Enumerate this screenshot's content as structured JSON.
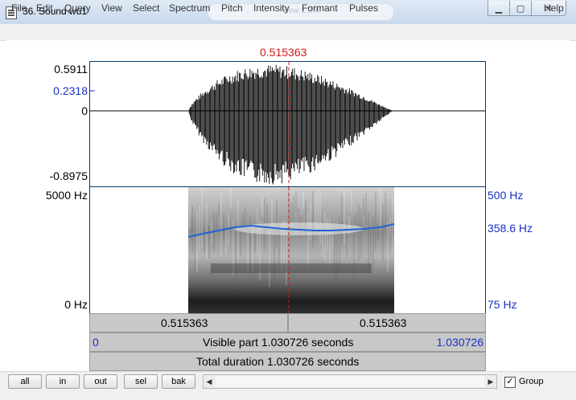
{
  "window": {
    "title": "36. Sound wu1",
    "ghost_text": "View 1.2.8"
  },
  "menu": {
    "items": [
      "File",
      "Edit",
      "Query",
      "View",
      "Select",
      "Spectrum",
      "Pitch",
      "Intensity",
      "Formant",
      "Pulses"
    ],
    "help": "Help"
  },
  "cursor": {
    "time_label": "0.515363"
  },
  "waveform": {
    "y_max": "0.5911",
    "y_cursor": "0.2318",
    "y_zero": "0",
    "y_min": "-0.8975"
  },
  "spectrogram": {
    "freq_top": "5000 Hz",
    "freq_bottom": "0 Hz",
    "pitch_top": "500 Hz",
    "pitch_current": "358.6 Hz",
    "pitch_bottom": "75 Hz"
  },
  "bars": {
    "left_half": "0.515363",
    "right_half": "0.515363",
    "visible_start": "0",
    "visible_label": "Visible part 1.030726 seconds",
    "visible_end": "1.030726",
    "total_label": "Total duration 1.030726 seconds"
  },
  "toolbar": {
    "buttons": [
      "all",
      "in",
      "out",
      "sel",
      "bak"
    ],
    "group_label": "Group",
    "group_checked": true
  },
  "colors": {
    "cursor": "#d01818",
    "pitch_line": "#1f62d8",
    "axis_blue": "#1a2fc4"
  }
}
